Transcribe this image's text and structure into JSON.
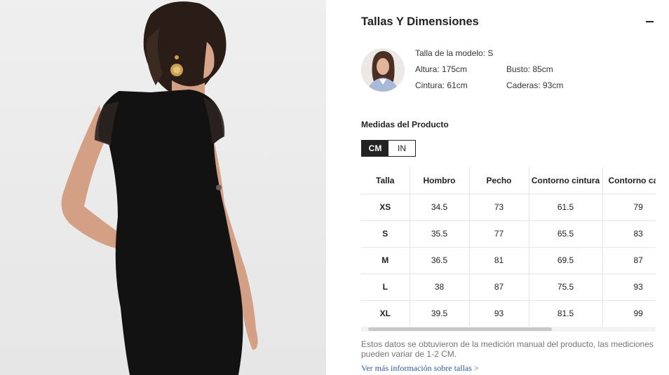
{
  "panel": {
    "title": "Tallas Y Dimensiones",
    "collapse_icon": "minus-icon"
  },
  "model": {
    "size_label": "Talla de la modelo: S",
    "height": "Altura: 175cm",
    "bust": "Busto: 85cm",
    "waist": "Cintura: 61cm",
    "hips": "Caderas: 93cm"
  },
  "measurements": {
    "title": "Medidas del Producto",
    "units": [
      "CM",
      "IN"
    ],
    "active_unit": "CM",
    "headers": [
      "Talla",
      "Hombro",
      "Pecho",
      "Contorno cintura",
      "Contorno ca"
    ],
    "rows": [
      [
        "XS",
        "34.5",
        "73",
        "61.5",
        "79"
      ],
      [
        "S",
        "35.5",
        "77",
        "65.5",
        "83"
      ],
      [
        "M",
        "36.5",
        "81",
        "69.5",
        "87"
      ],
      [
        "L",
        "38",
        "87",
        "75.5",
        "93"
      ],
      [
        "XL",
        "39.5",
        "93",
        "81.5",
        "99"
      ]
    ]
  },
  "note": "Estos datos se obtuvieron de la medición manual del producto, las mediciones pueden variar de 1-2 CM.",
  "more_link": "Ver más información sobre tallas >",
  "colors": {
    "active_toggle": "#222222",
    "link": "#2c5a9e",
    "note": "#767676"
  }
}
